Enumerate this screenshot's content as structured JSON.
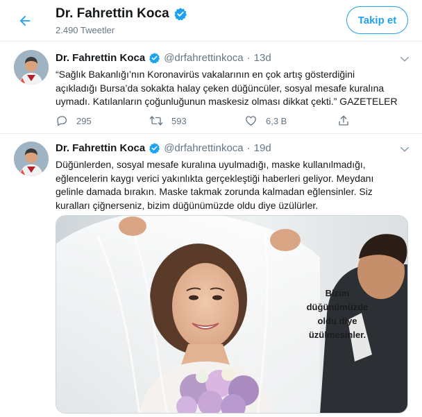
{
  "header": {
    "back_icon": "arrow-left-icon",
    "name": "Dr. Fahrettin Koca",
    "tweet_count": "2.490 Tweetler",
    "follow_label": "Takip et",
    "accent": "#1da1f2"
  },
  "tweets": [
    {
      "name": "Dr. Fahrettin Koca",
      "handle": "@drfahrettinkoca",
      "separator": "·",
      "time": "13d",
      "text_lines": [
        "“Sağlık Bakanlığı’nın Koronavirüs vakalarının en çok artış gösterdiğini",
        "açıkladığı Bursa’da sokakta halay çeken düğüncüler, sosyal mesafe kuralına",
        "uymadı. Katılanların çoğunluğunun maskesiz olması dikkat çekti.” GAZETELER"
      ],
      "reply_count": "295",
      "retweet_count": "593",
      "like_count": "6,3 B"
    },
    {
      "name": "Dr. Fahrettin Koca",
      "handle": "@drfahrettinkoca",
      "separator": "·",
      "time": "19d",
      "text_lines": [
        "Düğünlerden, sosyal mesafe kuralına uyulmadığı, maske kullanılmadığı,",
        "eğlencelerin kaygı verici yakınlıkta gerçekleştiği haberleri geliyor. Meydanı",
        "gelinle damada bırakın. Maske takmak zorunda kalmadan eğlensinler. Siz",
        "kuralları çiğnerseniz, bizim düğünümüzde oldu diye üzülürler."
      ],
      "media_caption": [
        "Bizim",
        "düğünümüzde",
        "oldu diye",
        "üzülmesinler."
      ]
    }
  ],
  "icons": {
    "verified": "verified-badge-icon",
    "caret": "chevron-down-icon",
    "reply": "reply-icon",
    "retweet": "retweet-icon",
    "like": "heart-icon",
    "share": "share-icon"
  }
}
